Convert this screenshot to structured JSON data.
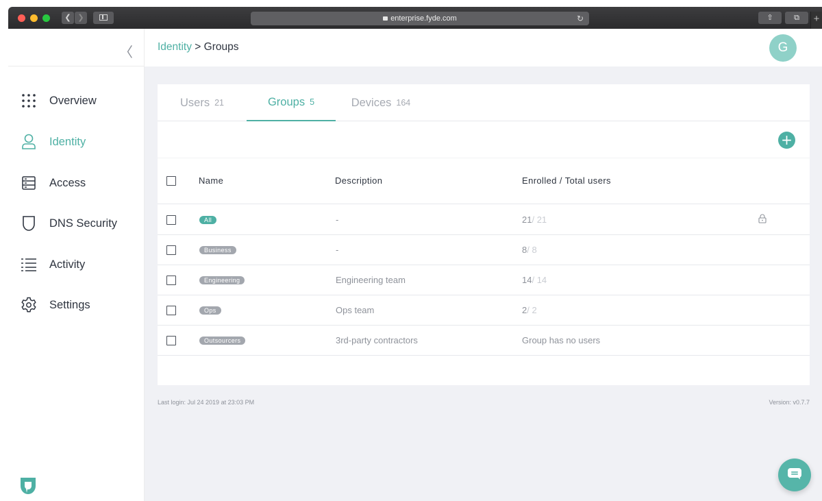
{
  "browser": {
    "url": "enterprise.fyde.com"
  },
  "header": {
    "breadcrumb_parent": "Identity",
    "breadcrumb_separator": " > ",
    "breadcrumb_current": "Groups",
    "avatar_initial": "G"
  },
  "sidebar": {
    "items": [
      {
        "label": "Overview",
        "icon": "grid-dots-icon",
        "active": false
      },
      {
        "label": "Identity",
        "icon": "user-icon",
        "active": true
      },
      {
        "label": "Access",
        "icon": "server-icon",
        "active": false
      },
      {
        "label": "DNS Security",
        "icon": "shield-icon",
        "active": false
      },
      {
        "label": "Activity",
        "icon": "list-icon",
        "active": false
      },
      {
        "label": "Settings",
        "icon": "gear-icon",
        "active": false
      }
    ]
  },
  "tabs": [
    {
      "label": "Users",
      "count": "21",
      "active": false
    },
    {
      "label": "Groups",
      "count": "5",
      "active": true
    },
    {
      "label": "Devices",
      "count": "164",
      "active": false
    }
  ],
  "table": {
    "columns": [
      "Name",
      "Description",
      "Enrolled / Total users"
    ],
    "rows": [
      {
        "name": "All",
        "description": "-",
        "enrolled": "21",
        "total": "/ 21",
        "locked": true,
        "primary": true
      },
      {
        "name": "Business",
        "description": "-",
        "enrolled": "8",
        "total": "/ 8",
        "locked": false,
        "primary": false
      },
      {
        "name": "Engineering",
        "description": "Engineering team",
        "enrolled": "14",
        "total": "/ 14",
        "locked": false,
        "primary": false
      },
      {
        "name": "Ops",
        "description": "Ops team",
        "enrolled": "2",
        "total": "/ 2",
        "locked": false,
        "primary": false
      },
      {
        "name": "Outsourcers",
        "description": "3rd-party contractors",
        "enrolled": "Group has no users",
        "total": "",
        "locked": false,
        "primary": false
      }
    ]
  },
  "footer": {
    "last_login": "Last login: Jul 24 2019 at 23:03 PM",
    "version": "Version: v0.7.7"
  },
  "colors": {
    "accent": "#4eb0a4",
    "badge_gray": "#a3a7ae",
    "background": "#f0f1f5"
  }
}
